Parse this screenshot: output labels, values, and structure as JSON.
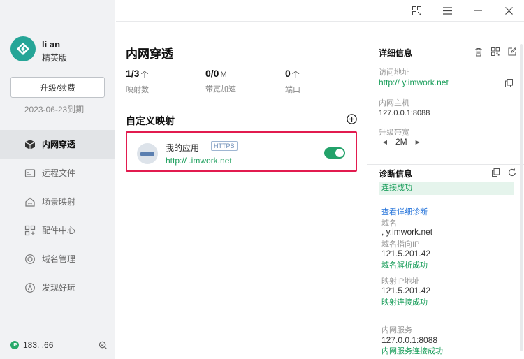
{
  "user": {
    "name": "li   an",
    "plan": "精英版",
    "upgrade_label": "升级/续费",
    "expiry": "2023-06-23到期"
  },
  "sidebar": {
    "items": [
      {
        "label": "内网穿透",
        "icon": "cube-icon",
        "active": true
      },
      {
        "label": "远程文件",
        "icon": "folder-icon",
        "active": false
      },
      {
        "label": "场景映射",
        "icon": "home-icon",
        "active": false
      },
      {
        "label": "配件中心",
        "icon": "grid-plus-icon",
        "active": false
      },
      {
        "label": "域名管理",
        "icon": "globe-icon",
        "active": false
      },
      {
        "label": "发现好玩",
        "icon": "compass-icon",
        "active": false
      }
    ],
    "ip_badge": "IP",
    "ip": "183.          .66"
  },
  "window": {
    "icons": [
      "qr-code-icon",
      "menu-icon",
      "minimize-icon",
      "close-icon"
    ]
  },
  "main": {
    "title": "内网穿透",
    "stats": [
      {
        "value": "1/3",
        "unit": "个",
        "label": "映射数"
      },
      {
        "value": "0/0",
        "unit": "M",
        "label": "带宽加速"
      },
      {
        "value": "0",
        "unit": "个",
        "label": "端口"
      }
    ],
    "section_title": "自定义映射",
    "mapping": {
      "name": "我的应用",
      "protocol": "HTTPS",
      "url": "http://          .imwork.net",
      "enabled": true
    }
  },
  "details": {
    "title": "详细信息",
    "access_label": "访问地址",
    "access_url": "http://          y.imwork.net",
    "host_label": "内网主机",
    "host_value": "127.0.0.1:8088",
    "bandwidth_label": "升级带宽",
    "bandwidth_value": "2M",
    "bandwidth_dec": "◀",
    "bandwidth_inc": "▶"
  },
  "diagnosis": {
    "title": "诊断信息",
    "status": "连接成功",
    "detail_link": "查看详细诊断",
    "domain_label": "域名",
    "domain_value": ",        y.imwork.net",
    "domain_ip_label": "域名指向IP",
    "domain_ip_value": "121.5.201.42",
    "domain_ip_status": "域名解析成功",
    "mapped_ip_label": "映射IP地址",
    "mapped_ip_value": "121.5.201.42",
    "mapped_ip_status": "映射连接成功",
    "service_label": "内网服务",
    "service_value": "127.0.0.1:8088",
    "service_status": "内网服务连接成功"
  }
}
